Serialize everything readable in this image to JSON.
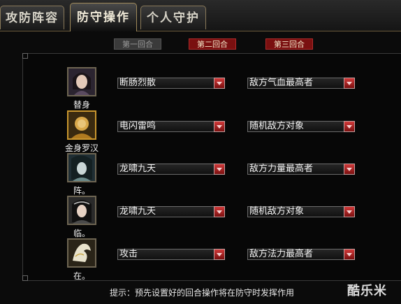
{
  "tabs": [
    {
      "label": "攻防阵容",
      "active": false
    },
    {
      "label": "防守操作",
      "active": true
    },
    {
      "label": "个人守护",
      "active": false
    }
  ],
  "rounds": [
    {
      "label": "第一回合",
      "active": false
    },
    {
      "label": "第二回合",
      "active": true
    },
    {
      "label": "第三回合",
      "active": true
    }
  ],
  "rows": [
    {
      "name": "替身",
      "skill": "断肠烈散",
      "target": "敌方气血最高者",
      "portrait_icon": "male-warrior-portrait-icon"
    },
    {
      "name": "金身罗汉",
      "skill": "电闪雷鸣",
      "target": "随机敌方对象",
      "portrait_icon": "golden-monk-portrait-icon"
    },
    {
      "name": "阵。",
      "skill": "龙啸九天",
      "target": "敌方力量最高者",
      "portrait_icon": "female-mage-portrait-icon"
    },
    {
      "name": "临。",
      "skill": "龙啸九天",
      "target": "随机敌方对象",
      "portrait_icon": "female-warrior-portrait-icon"
    },
    {
      "name": "在。",
      "skill": "攻击",
      "target": "敌方法力最高者",
      "portrait_icon": "white-dragon-portrait-icon"
    }
  ],
  "tip": "提示：预先设置好的回合操作将在防守时发挥作用",
  "watermark": "酷乐米",
  "colors": {
    "accent_red": "#7a1010",
    "dropdown_red": "#d23a3a",
    "gold_border": "#c9962e"
  }
}
